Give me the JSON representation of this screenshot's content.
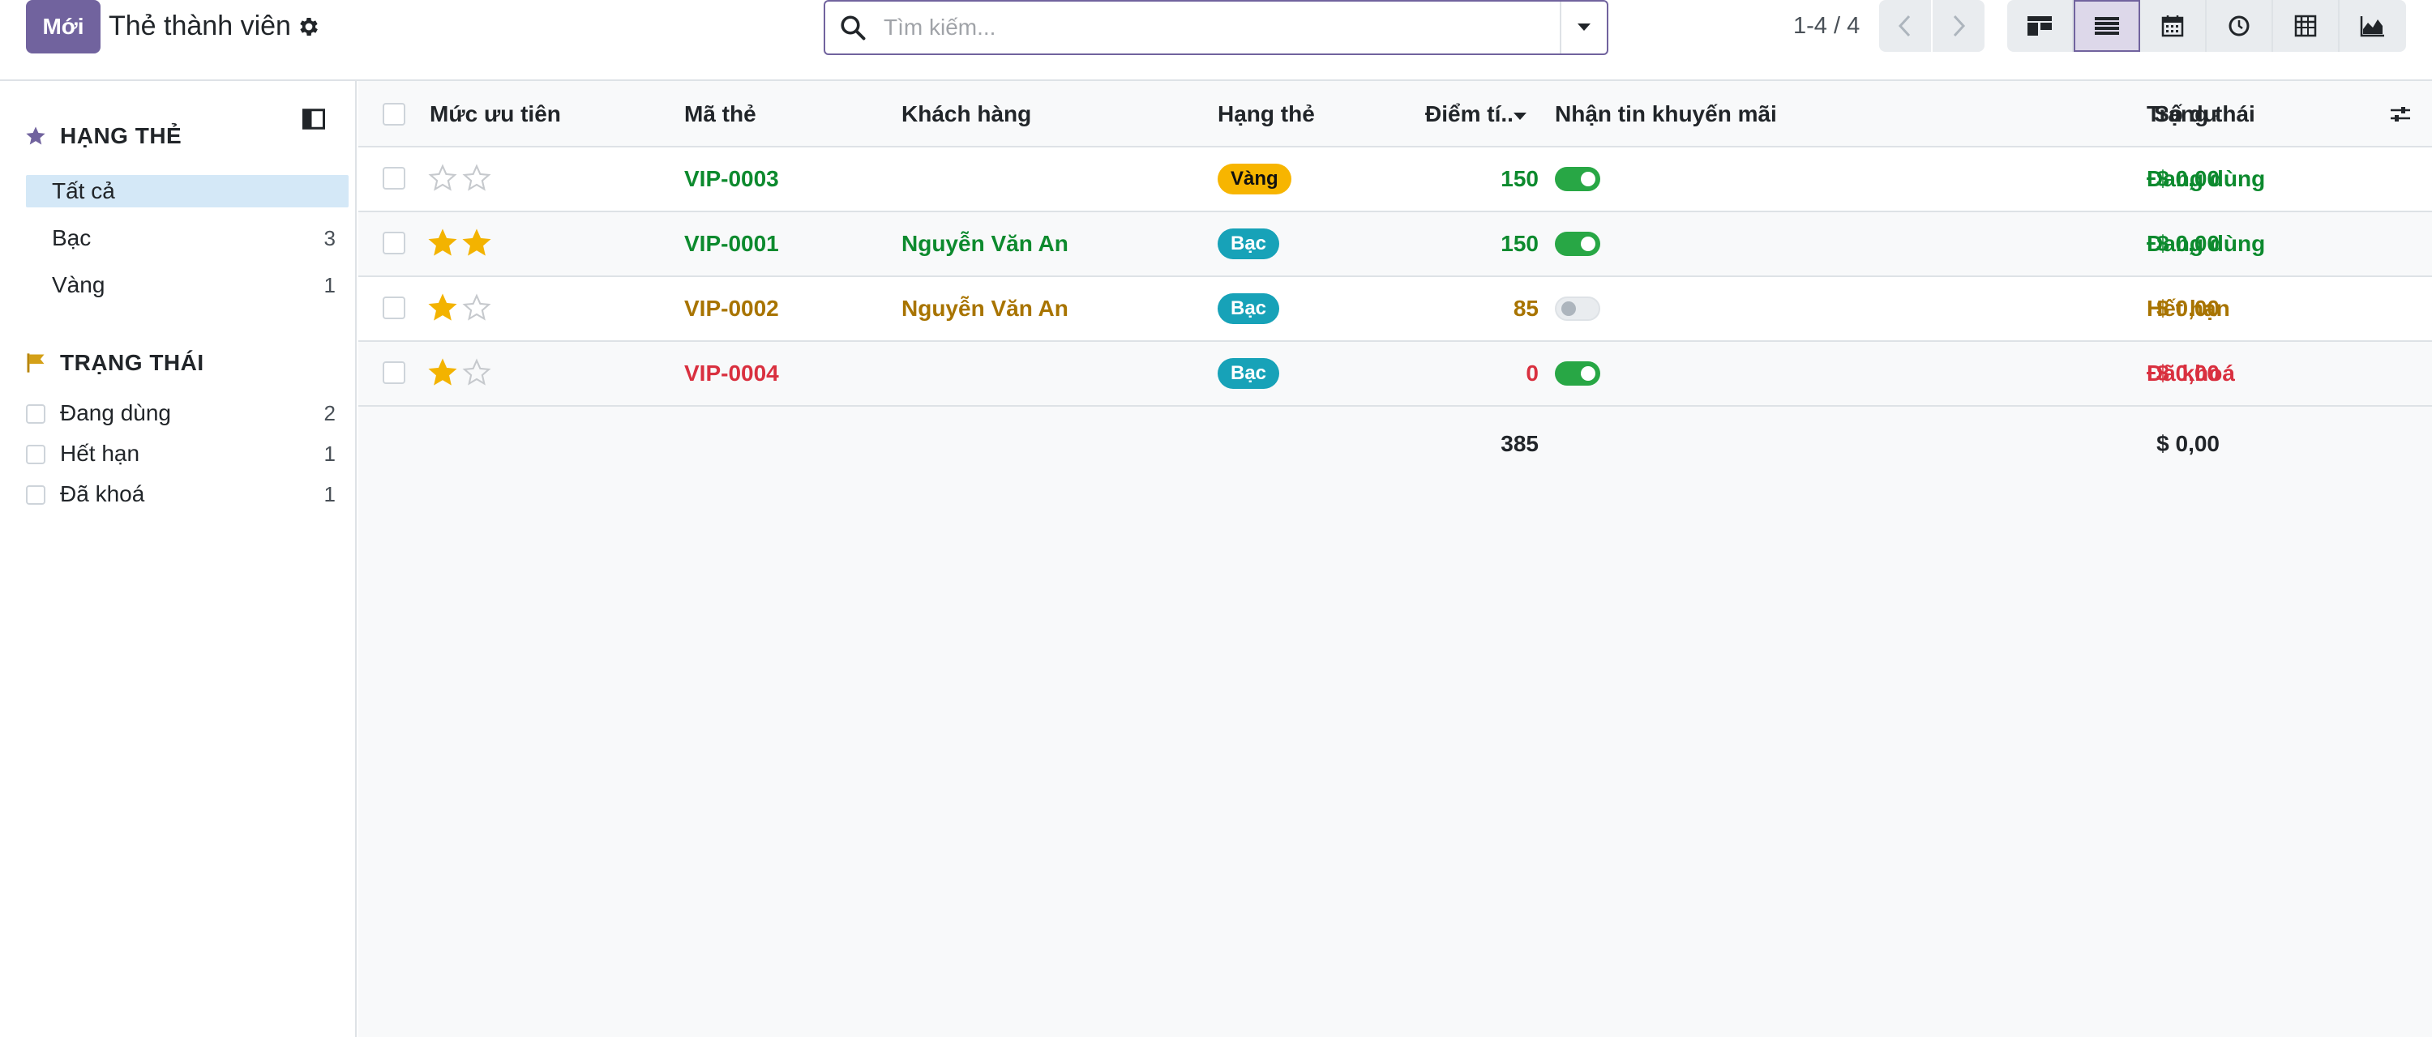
{
  "header": {
    "new_button": "Mới",
    "title": "Thẻ thành viên",
    "search_placeholder": "Tìm kiếm...",
    "pager": "1-4 / 4",
    "views": [
      "kanban",
      "list",
      "calendar",
      "activity",
      "pivot",
      "graph"
    ],
    "active_view": "list",
    "accent_color": "#71639e"
  },
  "sidebar": {
    "section1": {
      "title": "HẠNG THẺ",
      "items": [
        {
          "label": "Tất cả",
          "count": ""
        },
        {
          "label": "Bạc",
          "count": "3"
        },
        {
          "label": "Vàng",
          "count": "1"
        }
      ]
    },
    "section2": {
      "title": "TRẠNG THÁI",
      "items": [
        {
          "label": "Đang dùng",
          "count": "2"
        },
        {
          "label": "Hết hạn",
          "count": "1"
        },
        {
          "label": "Đã khoá",
          "count": "1"
        }
      ]
    }
  },
  "table": {
    "columns": {
      "priority": "Mức ưu tiên",
      "code": "Mã thẻ",
      "customer": "Khách hàng",
      "tier": "Hạng thẻ",
      "points": "Điểm tí..",
      "promo": "Nhận tin khuyến mãi",
      "balance": "Số dư",
      "status": "Trạng thái"
    },
    "rows": [
      {
        "stars": 0,
        "code": "VIP-0003",
        "customer": "",
        "tier": "Vàng",
        "tier_style": "vang",
        "points": "150",
        "promo": true,
        "balance": "$ 0,00",
        "status": "Đang dùng",
        "state": "active"
      },
      {
        "stars": 2,
        "code": "VIP-0001",
        "customer": "Nguyễn Văn An",
        "tier": "Bạc",
        "tier_style": "bac",
        "points": "150",
        "promo": true,
        "balance": "$ 0,00",
        "status": "Đang dùng",
        "state": "active"
      },
      {
        "stars": 1,
        "code": "VIP-0002",
        "customer": "Nguyễn Văn An",
        "tier": "Bạc",
        "tier_style": "bac",
        "points": "85",
        "promo": false,
        "balance": "$ 0,00",
        "status": "Hết hạn",
        "state": "exp"
      },
      {
        "stars": 1,
        "code": "VIP-0004",
        "customer": "",
        "tier": "Bạc",
        "tier_style": "bac",
        "points": "0",
        "promo": true,
        "balance": "$ 0,00",
        "status": "Đã khoá",
        "state": "lock"
      }
    ],
    "totals": {
      "points": "385",
      "balance": "$ 0,00"
    }
  }
}
